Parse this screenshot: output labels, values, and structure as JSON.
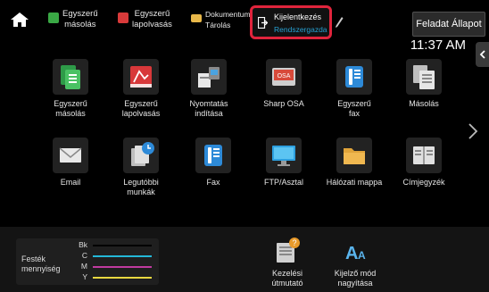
{
  "topbar": {
    "home_icon": "home-icon",
    "shortcuts": [
      {
        "label": "Egyszerű\nmásolás",
        "icon": "copy-icon",
        "color": "#3aa845"
      },
      {
        "label": "Egyszerű\nlapolvasás",
        "icon": "scan-icon",
        "color": "#d93a3a"
      },
      {
        "label": "Dokumentum\nTárolás",
        "icon": "folder-icon",
        "color": "#e8b84a"
      }
    ],
    "login": {
      "line1": "Kijelentkezés",
      "line2": "Rendszergazda",
      "highlight": "#e0243c",
      "accent": "#27a2d4"
    },
    "job_status": "Feladat Állapot"
  },
  "clock": "11:37 AM",
  "apps": [
    {
      "label": "Egyszerű\nmásolás",
      "icon": "copy-icon"
    },
    {
      "label": "Egyszerű\nlapolvasás",
      "icon": "scan-icon"
    },
    {
      "label": "Nyomtatás\nindítása",
      "icon": "print-release-icon"
    },
    {
      "label": "Sharp OSA",
      "icon": "sharp-osa-icon"
    },
    {
      "label": "Egyszerű\nfax",
      "icon": "fax-icon"
    },
    {
      "label": "Másolás",
      "icon": "copy-icon"
    },
    {
      "label": "Email",
      "icon": "email-icon"
    },
    {
      "label": "Legutóbbi\nmunkák",
      "icon": "recent-jobs-icon"
    },
    {
      "label": "Fax",
      "icon": "fax-icon"
    },
    {
      "label": "FTP/Asztal",
      "icon": "ftp-desktop-icon"
    },
    {
      "label": "Hálózati mappa",
      "icon": "network-folder-icon"
    },
    {
      "label": "Címjegyzék",
      "icon": "address-book-icon"
    }
  ],
  "toner": {
    "label": "Festék\nmennyiség",
    "rows": [
      {
        "key": "Bk",
        "color": "#000000"
      },
      {
        "key": "C",
        "color": "#24b8d8"
      },
      {
        "key": "M",
        "color": "#c03aa0"
      },
      {
        "key": "Y",
        "color": "#e8d840"
      }
    ]
  },
  "bottom_apps": [
    {
      "label": "Kezelési\nútmutató",
      "icon": "manual-icon"
    },
    {
      "label": "Kijelző mód\nnagyítása",
      "icon": "text-enlarge-icon"
    }
  ]
}
